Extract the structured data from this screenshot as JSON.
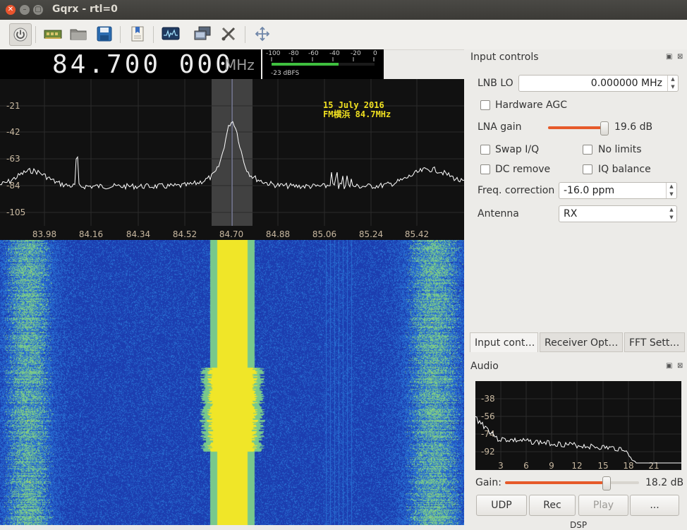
{
  "window": {
    "title": "Gqrx  - rtl=0"
  },
  "toolbar": {
    "items": [
      "power-icon",
      "hardware-icon",
      "open-folder-icon",
      "save-icon",
      "bookmark-icon",
      "fft-display-icon",
      "remote-control-icon",
      "tools-icon",
      "move-icon"
    ]
  },
  "frequency": {
    "value": "84.700 000",
    "unit": "MHz"
  },
  "signal_meter": {
    "scale": [
      "-100",
      "-80",
      "-60",
      "-40",
      "-20",
      "0"
    ],
    "readout": "-23 dBFS",
    "level_fraction": 0.65
  },
  "plot": {
    "y_ticks": [
      "-21",
      "-42",
      "-63",
      "-84",
      "-105"
    ],
    "x_ticks": [
      "83.98",
      "84.16",
      "84.34",
      "84.52",
      "84.70",
      "84.88",
      "85.06",
      "85.24",
      "85.42"
    ],
    "annotation_line1": "15 July 2016",
    "annotation_line2": "FM横浜 84.7MHz",
    "colors": {
      "background": "#111111",
      "trace": "#ffffff",
      "grid": "#2c2c2c",
      "filter": "#4a4a4a",
      "tick_text": "#c8b8a0"
    }
  },
  "waterfall": {
    "colors": {
      "noise": "#1c3fb0",
      "signal": "#f0e830"
    }
  },
  "input_controls": {
    "title": "Input controls",
    "lnb_lo_label": "LNB LO",
    "lnb_lo_value": "0.000000 MHz",
    "hardware_agc_label": "Hardware AGC",
    "lna_gain_label": "LNA gain",
    "lna_gain_value": "19.6 dB",
    "lna_gain_fraction": 0.92,
    "swap_iq_label": "Swap I/Q",
    "no_limits_label": "No limits",
    "dc_remove_label": "DC remove",
    "iq_balance_label": "IQ balance",
    "freq_correction_label": "Freq. correction",
    "freq_correction_value": "-16.0 ppm",
    "antenna_label": "Antenna",
    "antenna_value": "RX"
  },
  "tabs": [
    "Input cont…",
    "Receiver Opt…",
    "FFT Sett…"
  ],
  "audio": {
    "title": "Audio",
    "y_ticks": [
      "-38",
      "-56",
      "-74",
      "-92"
    ],
    "x_ticks": [
      "3",
      "6",
      "9",
      "12",
      "15",
      "18",
      "21"
    ],
    "gain_label": "Gain:",
    "gain_value": "18.2 dB",
    "gain_fraction": 0.75,
    "buttons": [
      "UDP",
      "Rec",
      "Play",
      "..."
    ],
    "partial_label": "DSP"
  }
}
